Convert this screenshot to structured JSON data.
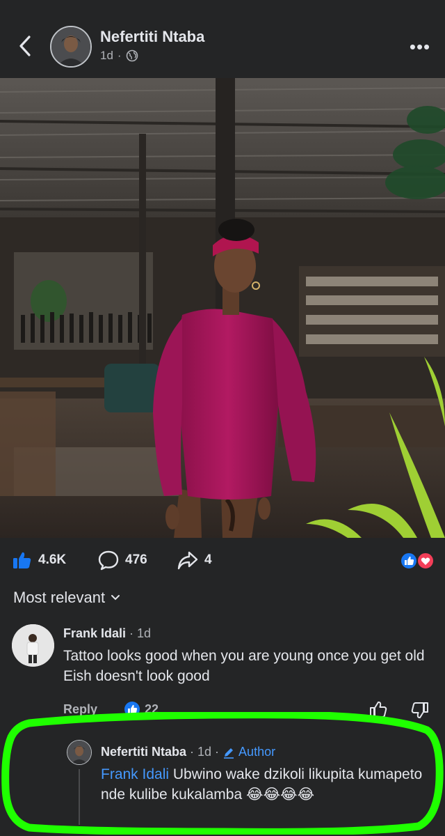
{
  "post": {
    "author": "Nefertiti Ntaba",
    "time": "1d",
    "time_separator": "·",
    "privacy_icon": "globe-icon",
    "more_label": "•••"
  },
  "stats": {
    "likes": "4.6K",
    "comments": "476",
    "shares": "4"
  },
  "sort": {
    "label": "Most relevant"
  },
  "comments": [
    {
      "author": "Frank Idali",
      "time": "· 1d",
      "text": "Tattoo looks good when you are young once you get old Eish doesn't look good",
      "reply_label": "Reply",
      "reaction_count": "22"
    }
  ],
  "reply": {
    "author": "Nefertiti Ntaba",
    "time": "· 1d ·",
    "badge": "Author",
    "mention": "Frank Idali",
    "text": " Ubwino wake dzikoli likupita kumapeto nde kulibe kukalamba ",
    "emojis": "😂😂😂😂"
  },
  "colors": {
    "background": "#242526",
    "accent_blue": "#1877f2",
    "link_blue": "#4599ff",
    "highlight_green": "#1fff00",
    "dress_magenta": "#a3155a"
  }
}
